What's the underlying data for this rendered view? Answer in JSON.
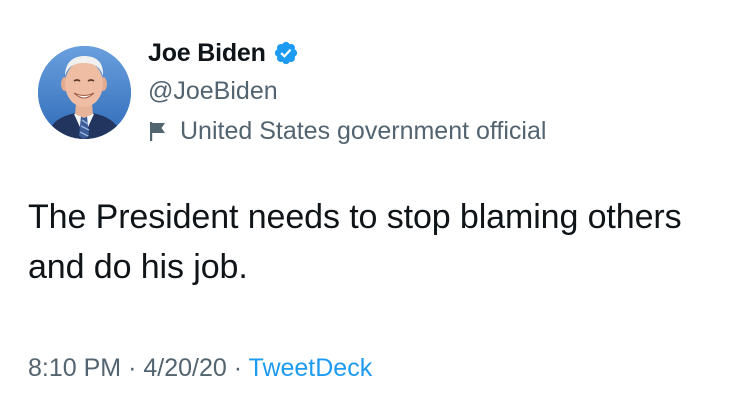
{
  "author": {
    "name": "Joe Biden",
    "handle": "@JoeBiden",
    "label": "United States government official",
    "verified": true
  },
  "tweet": {
    "text": "The President needs to stop blaming others and do his job.",
    "time": "8:10 PM",
    "date": "4/20/20",
    "separator": "·",
    "source": "TweetDeck"
  },
  "colors": {
    "verified_badge": "#1d9bf0",
    "secondary_text": "#536471",
    "link": "#1d9bf0",
    "primary_text": "#0f1419"
  },
  "icons": {
    "verified": "verified-badge-icon",
    "label": "flag-icon"
  }
}
